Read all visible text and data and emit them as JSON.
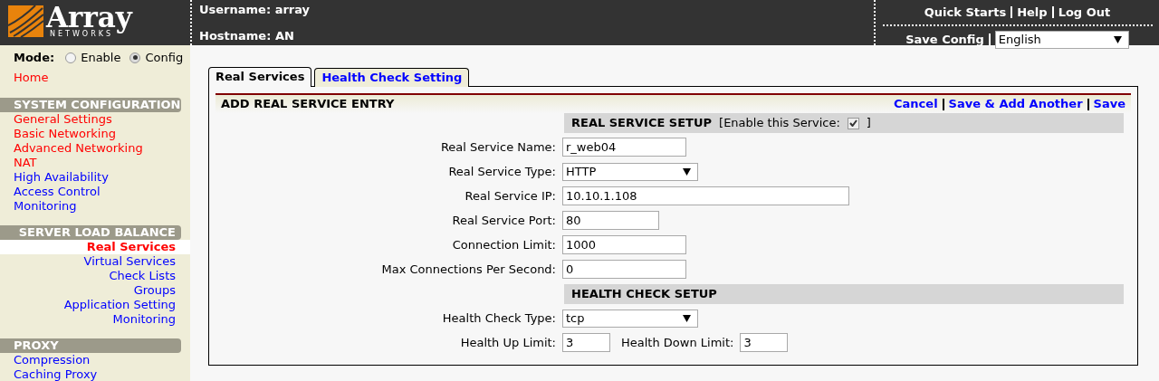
{
  "header": {
    "logo": {
      "word": "Array",
      "sub": "NETWORKS"
    },
    "username": "Username: array",
    "hostname": "Hostname: AN",
    "links": [
      "Quick Starts",
      "Help",
      "Log Out"
    ],
    "save_config": "Save Config",
    "language": "English"
  },
  "sidebar": {
    "mode_label": "Mode:",
    "modes": [
      {
        "label": "Enable",
        "selected": false
      },
      {
        "label": "Config",
        "selected": true
      }
    ],
    "home": {
      "label": "Home",
      "color": "#ff0000"
    },
    "sections": [
      {
        "title": "SYSTEM CONFIGURATION",
        "kind": "left",
        "items": [
          {
            "label": "General Settings",
            "color": "#ff0000",
            "selected": false
          },
          {
            "label": "Basic Networking",
            "color": "#ff0000",
            "selected": false
          },
          {
            "label": "Advanced Networking",
            "color": "#ff0000",
            "selected": false
          },
          {
            "label": "NAT",
            "color": "#ff0000",
            "selected": false
          },
          {
            "label": "High Availability",
            "color": "#0000ff",
            "selected": false
          },
          {
            "label": "Access Control",
            "color": "#0000ff",
            "selected": false
          },
          {
            "label": "Monitoring",
            "color": "#0000ff",
            "selected": false
          }
        ]
      },
      {
        "title": "SERVER LOAD BALANCE",
        "kind": "right",
        "items": [
          {
            "label": "Real Services",
            "color": "#ff0000",
            "selected": true
          },
          {
            "label": "Virtual Services",
            "color": "#0000ff",
            "selected": false
          },
          {
            "label": "Check Lists",
            "color": "#0000ff",
            "selected": false
          },
          {
            "label": "Groups",
            "color": "#0000ff",
            "selected": false
          },
          {
            "label": "Application Setting",
            "color": "#0000ff",
            "selected": false
          },
          {
            "label": "Monitoring",
            "color": "#0000ff",
            "selected": false
          }
        ]
      },
      {
        "title": "PROXY",
        "kind": "left",
        "items": [
          {
            "label": "Compression",
            "color": "#0000ff",
            "selected": false
          },
          {
            "label": "Caching Proxy",
            "color": "#0000ff",
            "selected": false
          }
        ]
      }
    ]
  },
  "tabs": [
    {
      "label": "Real Services",
      "selected": true
    },
    {
      "label": "Health Check Setting",
      "selected": false
    }
  ],
  "panel": {
    "title": "ADD REAL SERVICE ENTRY",
    "actions": [
      "Cancel",
      "Save & Add Another",
      "Save"
    ],
    "setup": {
      "title": "REAL SERVICE SETUP",
      "enable_label": "[Enable this Service:",
      "enable_close": "]",
      "checked": true
    },
    "fields": [
      {
        "label": "Real Service Name:",
        "kind": "text",
        "value": "r_web04"
      },
      {
        "label": "Real Service Type:",
        "kind": "select",
        "value": "HTTP"
      },
      {
        "label": "Real Service IP:",
        "kind": "text",
        "value": "10.10.1.108"
      },
      {
        "label": "Real Service Port:",
        "kind": "text",
        "value": "80"
      },
      {
        "label": "Connection Limit:",
        "kind": "text",
        "value": "1000"
      },
      {
        "label": "Max Connections Per Second:",
        "kind": "text",
        "value": "0"
      }
    ],
    "health": {
      "title": "HEALTH CHECK SETUP",
      "type_label": "Health Check Type:",
      "type_value": "tcp",
      "up_label": "Health Up Limit:",
      "up_value": "3",
      "down_label": "Health Down Limit:",
      "down_value": "3"
    }
  }
}
